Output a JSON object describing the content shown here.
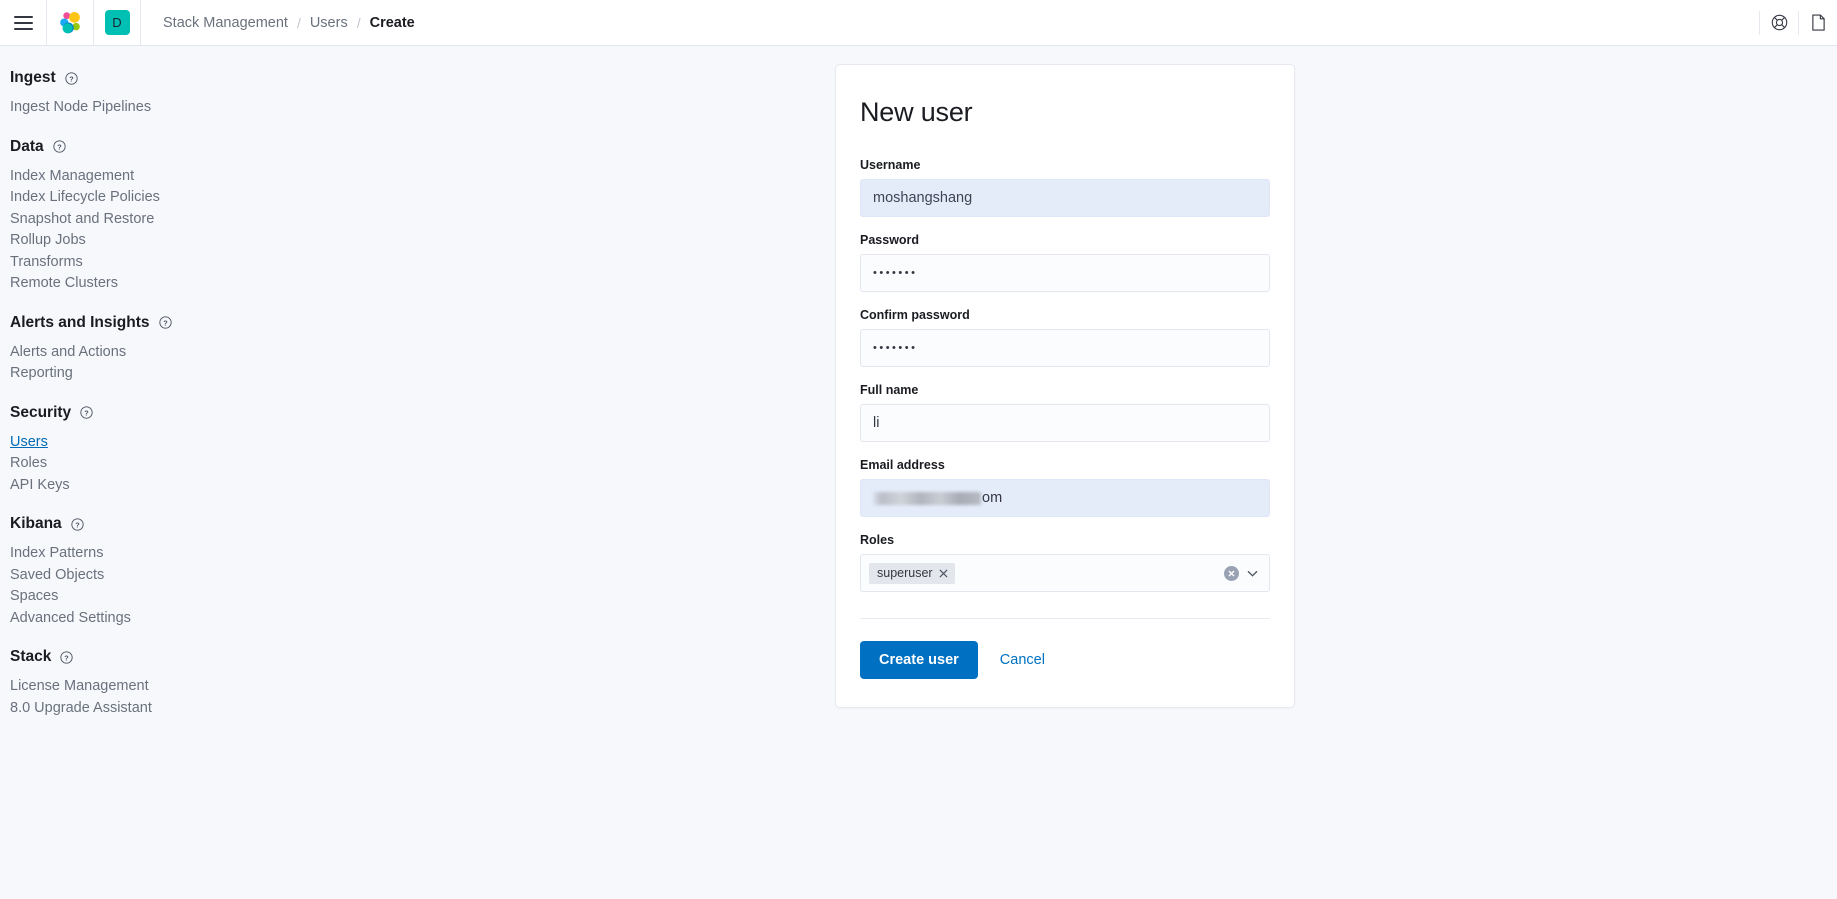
{
  "topbar": {
    "menu_icon": "hamburger-menu-icon",
    "logo_icon": "elastic-logo-icon",
    "space_badge": "D",
    "breadcrumbs": [
      {
        "label": "Stack Management",
        "active": false
      },
      {
        "label": "Users",
        "active": false
      },
      {
        "label": "Create",
        "active": true
      }
    ],
    "separator": "/",
    "help_icon": "life-ring-help-icon",
    "docs_icon": "document-page-icon"
  },
  "sidebar": {
    "groups": [
      {
        "title": "Ingest",
        "has_help": true,
        "items": [
          {
            "label": "Ingest Node Pipelines",
            "active": false
          }
        ]
      },
      {
        "title": "Data",
        "has_help": true,
        "items": [
          {
            "label": "Index Management",
            "active": false
          },
          {
            "label": "Index Lifecycle Policies",
            "active": false
          },
          {
            "label": "Snapshot and Restore",
            "active": false
          },
          {
            "label": "Rollup Jobs",
            "active": false
          },
          {
            "label": "Transforms",
            "active": false
          },
          {
            "label": "Remote Clusters",
            "active": false
          }
        ]
      },
      {
        "title": "Alerts and Insights",
        "has_help": true,
        "items": [
          {
            "label": "Alerts and Actions",
            "active": false
          },
          {
            "label": "Reporting",
            "active": false
          }
        ]
      },
      {
        "title": "Security",
        "has_help": true,
        "items": [
          {
            "label": "Users",
            "active": true
          },
          {
            "label": "Roles",
            "active": false
          },
          {
            "label": "API Keys",
            "active": false
          }
        ]
      },
      {
        "title": "Kibana",
        "has_help": true,
        "items": [
          {
            "label": "Index Patterns",
            "active": false
          },
          {
            "label": "Saved Objects",
            "active": false
          },
          {
            "label": "Spaces",
            "active": false
          },
          {
            "label": "Advanced Settings",
            "active": false
          }
        ]
      },
      {
        "title": "Stack",
        "has_help": true,
        "items": [
          {
            "label": "License Management",
            "active": false
          },
          {
            "label": "8.0 Upgrade Assistant",
            "active": false
          }
        ]
      }
    ]
  },
  "form": {
    "title": "New user",
    "username": {
      "label": "Username",
      "value": "moshangshang",
      "placeholder": ""
    },
    "password": {
      "label": "Password",
      "value": "•••••••",
      "placeholder": ""
    },
    "confirm_password": {
      "label": "Confirm password",
      "value": "•••••••",
      "placeholder": ""
    },
    "full_name": {
      "label": "Full name",
      "value": "li",
      "placeholder": ""
    },
    "email": {
      "label": "Email address",
      "value_visible_tail": "om",
      "redacted": true,
      "placeholder": ""
    },
    "roles": {
      "label": "Roles",
      "selected": [
        "superuser"
      ],
      "clear_icon": "clear-circle-icon",
      "dropdown_icon": "chevron-down-icon",
      "remove_icon": "close-x-icon"
    },
    "submit_label": "Create user",
    "cancel_label": "Cancel"
  },
  "colors": {
    "accent": "#0071c2",
    "link": "#006bb4",
    "space_badge": "#00bfb3",
    "autofill": "#e4ecfa",
    "page_bg": "#f7f8fc"
  }
}
